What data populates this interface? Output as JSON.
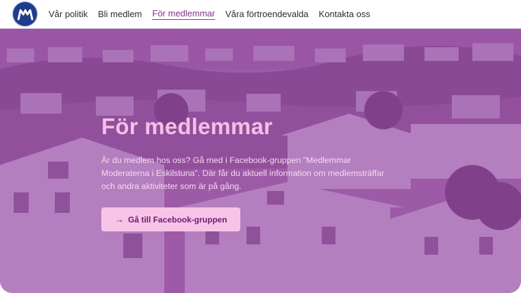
{
  "nav": {
    "logo_icon": "moderaterna-m-logo",
    "items": [
      {
        "label": "Vår politik",
        "active": false
      },
      {
        "label": "Bli medlem",
        "active": false
      },
      {
        "label": "För medlemmar",
        "active": true
      },
      {
        "label": "Våra förtroendevalda",
        "active": false
      },
      {
        "label": "Kontakta oss",
        "active": false
      }
    ]
  },
  "hero": {
    "title": "För medlemmar",
    "text": "Är du medlem hos oss? Gå med i Facebook-gruppen \"Medlemmar Moderaterna i Eskilstuna\". Där får du aktuell information om medlemsträffar och andra aktiviteter som är på gång.",
    "cta_arrow": "→",
    "cta_label": "Gå till Facebook-gruppen"
  },
  "colors": {
    "brand_blue": "#1f3d8c",
    "accent_purple": "#8a2f8c",
    "hero_overlay": "#9846a5",
    "title_pink": "#f4bfe6",
    "cta_bg": "#f7c4e8"
  }
}
